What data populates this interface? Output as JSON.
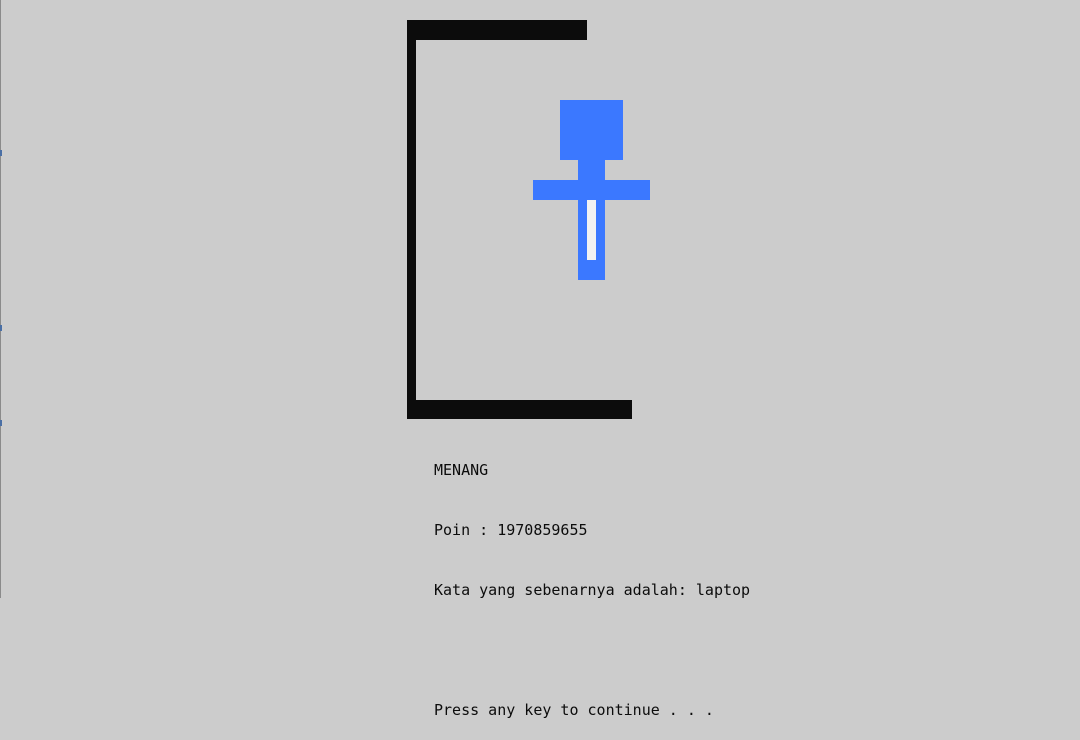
{
  "colors": {
    "background": "#cccccc",
    "gallows": "#0c0c0c",
    "figure": "#3b78ff",
    "figure_highlight": "#f2f2f2",
    "text": "#0c0c0c"
  },
  "game": {
    "result_label": "MENANG",
    "score_label": "Poin : ",
    "score_value": "1970859655",
    "answer_label": "Kata yang sebenarnya adalah: ",
    "answer_word": "laptop"
  },
  "prompt": {
    "continue_text": "Press any key to continue . . ."
  }
}
